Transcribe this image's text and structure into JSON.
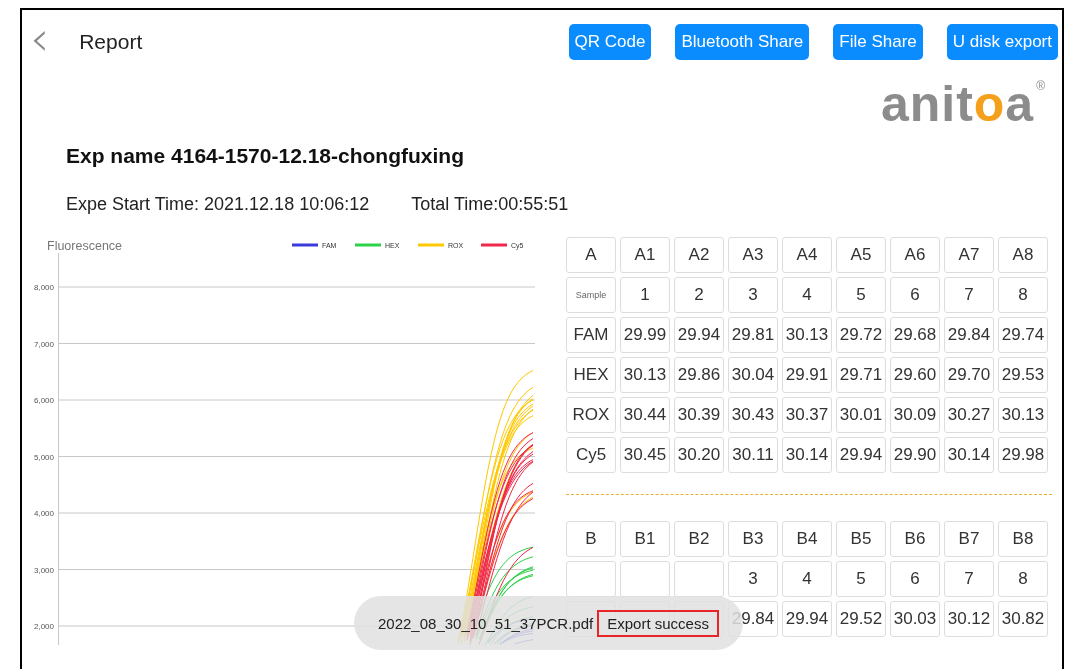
{
  "header": {
    "back": "‹",
    "title": "Report",
    "buttons": [
      "QR Code",
      "Bluetooth Share",
      "File Share",
      "U disk export"
    ]
  },
  "logo": {
    "parts": [
      {
        "text": "anit",
        "accent": false
      },
      {
        "text": "o",
        "accent": true
      },
      {
        "text": "a",
        "accent": false
      }
    ],
    "mark": "®"
  },
  "experiment": {
    "name": "Exp name 4164-1570-12.18-chongfuxing",
    "start_time": "Expe Start Time: 2021.12.18 10:06:12",
    "total_time": "Total Time:00:55:51"
  },
  "chart": {
    "ylabel": "Fluorescence",
    "yticks": [
      "8,000",
      "7,000",
      "6,000",
      "5,000",
      "4,000",
      "3,000",
      "2,000"
    ],
    "legend": [
      {
        "name": "FAM",
        "color": "#3b3bdc"
      },
      {
        "name": "HEX",
        "color": "#2ed24a"
      },
      {
        "name": "ROX",
        "color": "#ffc800"
      },
      {
        "name": "Cy5",
        "color": "#f0284a"
      }
    ]
  },
  "tables": [
    {
      "rows": [
        {
          "kind": "header",
          "cells": [
            "A",
            "A1",
            "A2",
            "A3",
            "A4",
            "A5",
            "A6",
            "A7",
            "A8"
          ]
        },
        {
          "kind": "sample",
          "cells": [
            "Sample",
            "1",
            "2",
            "3",
            "4",
            "5",
            "6",
            "7",
            "8"
          ]
        },
        {
          "kind": "channel",
          "cells": [
            "FAM",
            "29.99",
            "29.94",
            "29.81",
            "30.13",
            "29.72",
            "29.68",
            "29.84",
            "29.74"
          ]
        },
        {
          "kind": "channel",
          "cells": [
            "HEX",
            "30.13",
            "29.86",
            "30.04",
            "29.91",
            "29.71",
            "29.60",
            "29.70",
            "29.53"
          ]
        },
        {
          "kind": "channel",
          "cells": [
            "ROX",
            "30.44",
            "30.39",
            "30.43",
            "30.37",
            "30.01",
            "30.09",
            "30.27",
            "30.13"
          ]
        },
        {
          "kind": "channel",
          "cells": [
            "Cy5",
            "30.45",
            "30.20",
            "30.11",
            "30.14",
            "29.94",
            "29.90",
            "30.14",
            "29.98"
          ]
        }
      ]
    },
    {
      "rows": [
        {
          "kind": "header",
          "cells": [
            "B",
            "B1",
            "B2",
            "B3",
            "B4",
            "B5",
            "B6",
            "B7",
            "B8"
          ]
        },
        {
          "kind": "sample",
          "cells": [
            "",
            "",
            "",
            "3",
            "4",
            "5",
            "6",
            "7",
            "8"
          ]
        },
        {
          "kind": "channel",
          "cells": [
            "",
            "",
            "",
            "29.84",
            "29.94",
            "29.52",
            "30.03",
            "30.12",
            "30.82"
          ]
        }
      ]
    }
  ],
  "toast": {
    "file": "2022_08_30_10_51_37PCR.pdf",
    "message": "Export success",
    "highlighted": true
  }
}
